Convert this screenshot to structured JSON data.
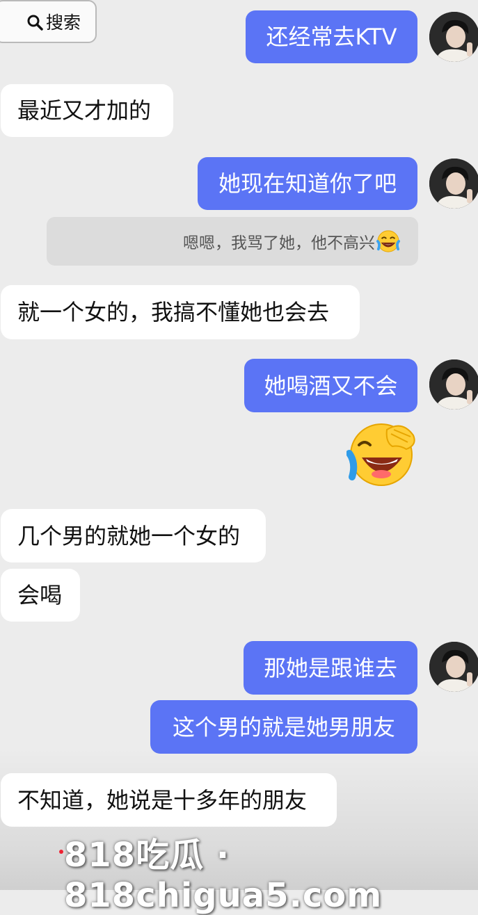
{
  "search": {
    "label": "搜索"
  },
  "messages": [
    {
      "text": "还经常去KTV"
    },
    {
      "text": "最近又才加的"
    },
    {
      "text": "她现在知道你了吧"
    },
    {
      "text": "就一个女的，我搞不懂她也会去"
    },
    {
      "text": "她喝酒又不会"
    },
    {
      "text": "几个男的就她一个女的"
    },
    {
      "text": "会喝"
    },
    {
      "text": "那她是跟谁去"
    },
    {
      "text": "这个男的就是她男朋友"
    },
    {
      "text": "不知道，她说是十多年的朋友"
    }
  ],
  "quote": {
    "text": "嗯嗯，我骂了她，他不高兴"
  },
  "watermark": {
    "text": "818吃瓜 · 818chigua5.com"
  },
  "colors": {
    "outgoing": "#5b74f5",
    "incoming": "#ffffff",
    "background": "#ececec"
  },
  "icons": {
    "search": "search-icon",
    "emoji": "tears-of-joy-emoji"
  }
}
